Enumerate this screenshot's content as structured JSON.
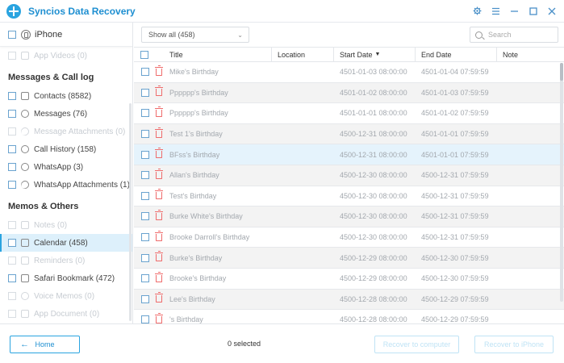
{
  "app": {
    "title": "Syncios Data Recovery"
  },
  "sidebar": {
    "device": "iPhone",
    "items_top": [
      {
        "label": "App Videos (0)",
        "icon": "video-icon",
        "disabled": true
      }
    ],
    "sections": [
      {
        "title": "Messages & Call log",
        "items": [
          {
            "label": "Contacts (8582)",
            "icon": "contacts-icon",
            "disabled": false
          },
          {
            "label": "Messages (76)",
            "icon": "message-icon",
            "disabled": false
          },
          {
            "label": "Message Attachments (0)",
            "icon": "paperclip-icon",
            "disabled": true
          },
          {
            "label": "Call History (158)",
            "icon": "phone-icon",
            "disabled": false
          },
          {
            "label": "WhatsApp (3)",
            "icon": "whatsapp-icon",
            "disabled": false
          },
          {
            "label": "WhatsApp Attachments (1)",
            "icon": "paperclip-icon",
            "disabled": false
          }
        ]
      },
      {
        "title": "Memos & Others",
        "items": [
          {
            "label": "Notes (0)",
            "icon": "notes-icon",
            "disabled": true
          },
          {
            "label": "Calendar (458)",
            "icon": "calendar-icon",
            "disabled": false,
            "active": true
          },
          {
            "label": "Reminders (0)",
            "icon": "reminders-icon",
            "disabled": true
          },
          {
            "label": "Safari Bookmark (472)",
            "icon": "bookmark-icon",
            "disabled": false
          },
          {
            "label": "Voice Memos (0)",
            "icon": "microphone-icon",
            "disabled": true
          },
          {
            "label": "App Document (0)",
            "icon": "document-icon",
            "disabled": true
          }
        ]
      }
    ]
  },
  "toolbar": {
    "filter_value": "Show all (458)",
    "search_placeholder": "Search"
  },
  "table": {
    "headers": {
      "title": "Title",
      "location": "Location",
      "start": "Start Date",
      "end": "End Date",
      "note": "Note"
    },
    "rows": [
      {
        "title": "Mike's Birthday",
        "location": "",
        "start": "4501-01-03 08:00:00",
        "end": "4501-01-04 07:59:59",
        "note": ""
      },
      {
        "title": "Pppppp's Birthday",
        "location": "",
        "start": "4501-01-02 08:00:00",
        "end": "4501-01-03 07:59:59",
        "note": ""
      },
      {
        "title": "Pppppp's Birthday",
        "location": "",
        "start": "4501-01-01 08:00:00",
        "end": "4501-01-02 07:59:59",
        "note": ""
      },
      {
        "title": "Test 1's Birthday",
        "location": "",
        "start": "4500-12-31 08:00:00",
        "end": "4501-01-01 07:59:59",
        "note": ""
      },
      {
        "title": "BFss's Birthday",
        "location": "",
        "start": "4500-12-31 08:00:00",
        "end": "4501-01-01 07:59:59",
        "note": "",
        "selected": true
      },
      {
        "title": "Allan's Birthday",
        "location": "",
        "start": "4500-12-30 08:00:00",
        "end": "4500-12-31 07:59:59",
        "note": ""
      },
      {
        "title": "Test's Birthday",
        "location": "",
        "start": "4500-12-30 08:00:00",
        "end": "4500-12-31 07:59:59",
        "note": ""
      },
      {
        "title": "Burke White's Birthday",
        "location": "",
        "start": "4500-12-30 08:00:00",
        "end": "4500-12-31 07:59:59",
        "note": ""
      },
      {
        "title": "Brooke Darroll's Birthday",
        "location": "",
        "start": "4500-12-30 08:00:00",
        "end": "4500-12-31 07:59:59",
        "note": ""
      },
      {
        "title": "Burke's Birthday",
        "location": "",
        "start": "4500-12-29 08:00:00",
        "end": "4500-12-30 07:59:59",
        "note": ""
      },
      {
        "title": "Brooke's Birthday",
        "location": "",
        "start": "4500-12-29 08:00:00",
        "end": "4500-12-30 07:59:59",
        "note": ""
      },
      {
        "title": "Lee's Birthday",
        "location": "",
        "start": "4500-12-28 08:00:00",
        "end": "4500-12-29 07:59:59",
        "note": ""
      },
      {
        "title": "'s Birthday",
        "location": "",
        "start": "4500-12-28 08:00:00",
        "end": "4500-12-29 07:59:59",
        "note": ""
      }
    ]
  },
  "footer": {
    "home_label": "Home",
    "selected_text": "0 selected",
    "recover_computer_label": "Recover to computer",
    "recover_iphone_label": "Recover to iPhone"
  },
  "colors": {
    "accent": "#2aa4e0",
    "selected_row": "#e5f3fc",
    "trash": "#ef6b6b"
  }
}
